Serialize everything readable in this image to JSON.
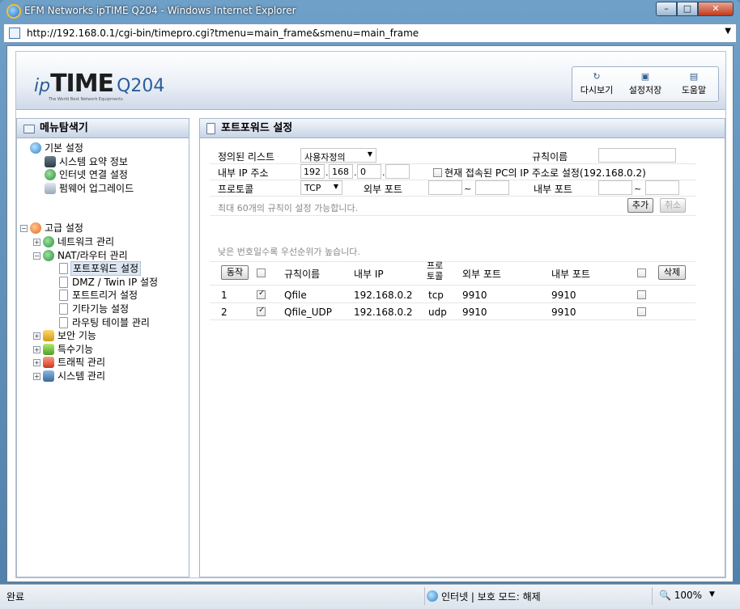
{
  "window": {
    "title": "EFM Networks ipTIME Q204 - Windows Internet Explorer",
    "url": "http://192.168.0.1/cgi-bin/timepro.cgi?tmenu=main_frame&smenu=main_frame"
  },
  "header": {
    "logo_ip": "ip",
    "logo_time": "TIME",
    "logo_model": "Q204",
    "logo_tagline": "The World Best Network Equipments",
    "refresh_label": "다시보기",
    "save_label": "설정저장",
    "help_label": "도움말"
  },
  "sidebar": {
    "title": "메뉴탐색기",
    "basic": "기본 설정",
    "basic_items": [
      "시스템 요약 정보",
      "인터넷 연결 설정",
      "펌웨어 업그레이드"
    ],
    "advanced": "고급 설정",
    "network": "네트워크 관리",
    "nat": "NAT/라우터 관리",
    "nat_items": [
      "포트포워드 설정",
      "DMZ / Twin IP 설정",
      "포트트리거 설정",
      "기타기능 설정",
      "라우팅 테이블 관리"
    ],
    "security": "보안 기능",
    "special": "특수기능",
    "traffic": "트래픽 관리",
    "system": "시스템 관리"
  },
  "main": {
    "title": "포트포워드 설정",
    "form": {
      "predefined_label": "정의된 리스트",
      "predefined_value": "사용자정의",
      "rule_name_label": "규칙이름",
      "rule_name_value": "",
      "internal_ip_label": "내부 IP 주소",
      "ip1": "192",
      "ip2": "168",
      "ip3": "0",
      "ip4": "",
      "use_current_pc_label": "현재 접속된 PC의 IP 주소로 설정(192.168.0.2)",
      "protocol_label": "프로토콜",
      "protocol_value": "TCP",
      "external_port_label": "외부 포트",
      "internal_port_label": "내부 포트",
      "tilde": "~",
      "max_rules_note": "최대 60개의 규칙이 설정 가능합니다.",
      "add_button": "추가",
      "cancel_button": "취소"
    },
    "priority_note": "낮은 번호일수록 우선순위가 높습니다.",
    "table": {
      "action_button": "동작",
      "delete_button": "삭제",
      "headers": {
        "rule_name": "규칙이름",
        "internal_ip": "내부 IP",
        "protocol_line1": "프로",
        "protocol_line2": "토콜",
        "external_port": "외부 포트",
        "internal_port": "내부 포트"
      },
      "rows": [
        {
          "no": "1",
          "checked": true,
          "name": "Qfile",
          "ip": "192.168.0.2",
          "proto": "tcp",
          "ext": "9910",
          "int": "9910"
        },
        {
          "no": "2",
          "checked": true,
          "name": "Qfile_UDP",
          "ip": "192.168.0.2",
          "proto": "udp",
          "ext": "9910",
          "int": "9910"
        }
      ]
    }
  },
  "status": {
    "done": "완료",
    "zone": "인터넷 | 보호 모드: 해제",
    "zoom": "100%"
  }
}
